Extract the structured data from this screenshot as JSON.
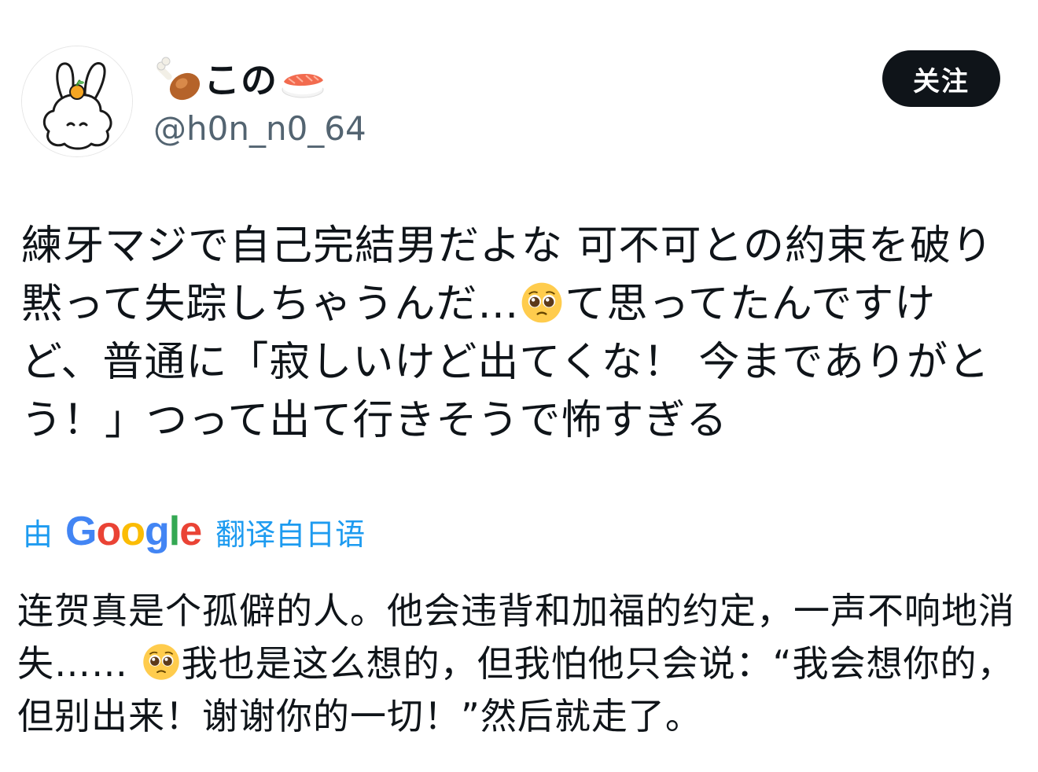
{
  "user": {
    "display_name_prefix_icon": "poultry-leg-emoji",
    "display_name_text": "この",
    "display_name_suffix_icon": "sushi-emoji",
    "handle": "@h0n_n0_64",
    "avatar_icon": "bunny-with-tangerine-avatar"
  },
  "follow_button": {
    "label": "关注"
  },
  "tweet": {
    "text_part1": "練牙マジで自己完結男だよな 可不可との約束を破り黙って失踪しちゃうんだ…",
    "emoji": "pleading-face-emoji",
    "text_part2": "て思ってたんですけど、普通に「寂しいけど出てくな！ 今までありがとう！」つって出て行きそうで怖すぎる"
  },
  "translation": {
    "by_label": "由",
    "google_label": "Google",
    "from_label": "翻译自日语",
    "text_part1": "连贺真是个孤僻的人。他会违背和加福的约定，一声不响地消失…… ",
    "emoji": "pleading-face-emoji",
    "text_part2": "我也是这么想的，但我怕他只会说：“我会想你的，但别出来！谢谢你的一切！”然后就走了。"
  },
  "colors": {
    "text": "#0f1419",
    "handle": "#536471",
    "link": "#1d9bf0",
    "button_bg": "#0f1419"
  }
}
